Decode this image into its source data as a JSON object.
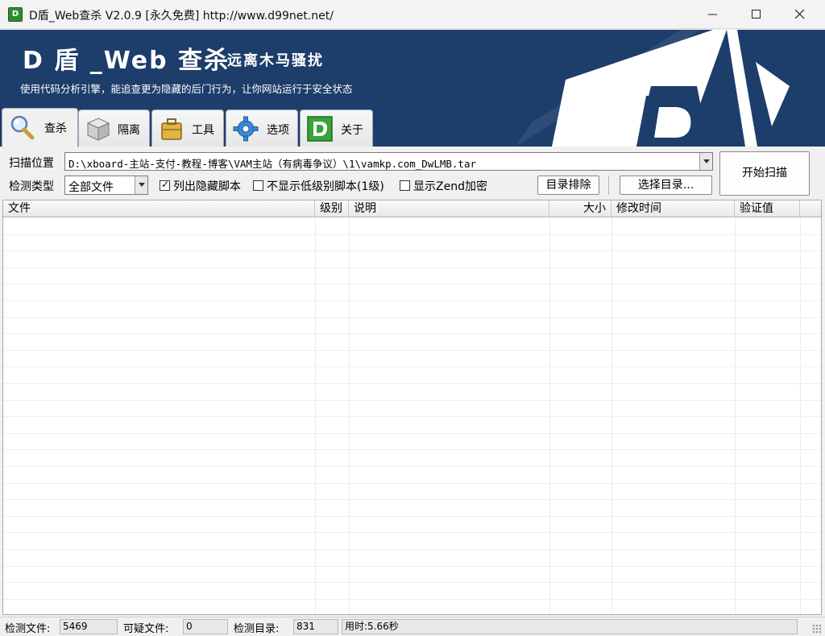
{
  "window": {
    "title": "D盾_Web查杀 V2.0.9 [永久免费] http://www.d99net.net/",
    "icon_text": "D"
  },
  "banner": {
    "title": "D 盾 _Web 查杀",
    "subtitle": "远离木马骚扰",
    "slogan": "使用代码分析引擎，能追查更为隐藏的后门行为，让你网站运行于安全状态"
  },
  "tabs": [
    {
      "label": "查杀",
      "icon": "magnifier-icon",
      "active": true
    },
    {
      "label": "隔离",
      "icon": "quarantine-box-icon",
      "active": false
    },
    {
      "label": "工具",
      "icon": "toolbox-icon",
      "active": false
    },
    {
      "label": "选项",
      "icon": "gear-icon",
      "active": false
    },
    {
      "label": "关于",
      "icon": "d-logo-icon",
      "active": false
    }
  ],
  "scan": {
    "path_label": "扫描位置",
    "path_value": "D:\\xboard-主站-支付-教程-博客\\VAM主站（有病毒争议）\\1\\vamkp.com_DwLMB.tar",
    "type_label": "检测类型",
    "type_value": "全部文件",
    "check_hidden_label": "列出隐藏脚本",
    "check_hidden_checked": true,
    "check_low_label": "不显示低级别脚本(1级)",
    "check_low_checked": false,
    "check_zend_label": "显示Zend加密",
    "check_zend_checked": false,
    "exclude_button": "目录排除",
    "select_dir_button": "选择目录...",
    "start_button": "开始扫描"
  },
  "table": {
    "columns": [
      "文件",
      "级别",
      "说明",
      "大小",
      "修改时间",
      "验证值"
    ],
    "rows": []
  },
  "status": {
    "files_label": "检测文件:",
    "files_value": "5469",
    "suspicious_label": "可疑文件:",
    "suspicious_value": "0",
    "dirs_label": "检测目录:",
    "dirs_value": "831",
    "time_label": "用时:5.66秒"
  },
  "colors": {
    "banner_bg": "#1d3d6b",
    "logo_white": "#ffffff"
  }
}
